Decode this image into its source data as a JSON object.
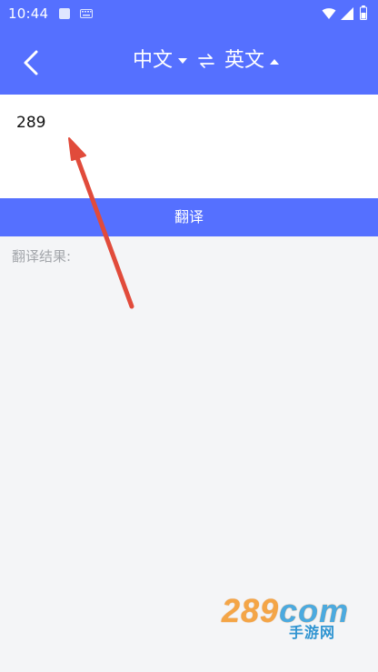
{
  "status_bar": {
    "time": "10:44",
    "icons": [
      "a-icon",
      "keyboard-icon",
      "wifi-icon",
      "signal-icon",
      "battery-icon"
    ]
  },
  "header": {
    "back_icon": "chevron-left-icon",
    "source_language": "中文",
    "target_language": "英文",
    "swap_icon": "swap-icon",
    "source_dropdown_icon": "caret-down-icon",
    "target_dropdown_icon": "caret-up-icon"
  },
  "input": {
    "value": "289"
  },
  "translate_button": {
    "label": "翻译"
  },
  "result": {
    "label": "翻译结果:"
  },
  "watermark": {
    "brand": "289",
    "brand_suffix": "com",
    "subtitle": "手游网"
  },
  "colors": {
    "primary": "#5570ff",
    "background": "#f4f5f7",
    "arrow": "#e14b3b",
    "watermark_orange": "#f4a13d",
    "watermark_blue": "#2f94d1"
  }
}
